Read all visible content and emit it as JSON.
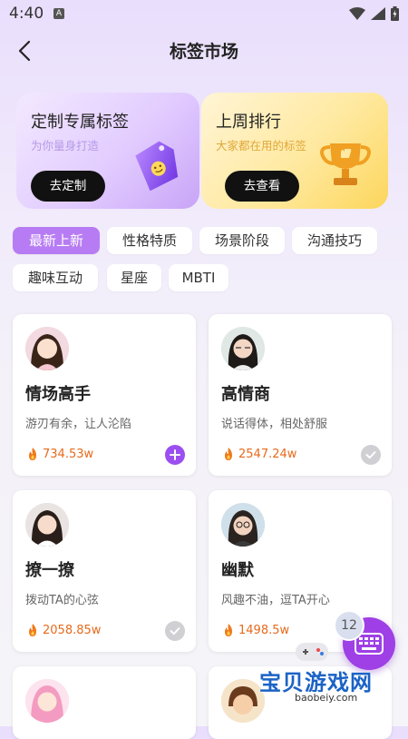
{
  "status": {
    "time": "4:40",
    "notif": "A"
  },
  "nav": {
    "title": "标签市场"
  },
  "promos": [
    {
      "title": "定制专属标签",
      "subtitle": "为你量身打造",
      "button": "去定制"
    },
    {
      "title": "上周排行",
      "subtitle": "大家都在用的标签",
      "button": "去查看"
    }
  ],
  "categories": [
    "最新上新",
    "性格特质",
    "场景阶段",
    "沟通技巧",
    "趣味互动",
    "星座",
    "MBTI"
  ],
  "active_category": "最新上新",
  "cards": [
    {
      "name": "情场高手",
      "desc": "游刃有余，让人沦陷",
      "hot": "734.53w",
      "state": "add"
    },
    {
      "name": "高情商",
      "desc": "说话得体，相处舒服",
      "hot": "2547.24w",
      "state": "added"
    },
    {
      "name": "撩一撩",
      "desc": "拨动TA的心弦",
      "hot": "2058.85w",
      "state": "added"
    },
    {
      "name": "幽默",
      "desc": "风趣不油，逗TA开心",
      "hot": "1498.5w",
      "state": "add"
    }
  ],
  "fab": {
    "badge": "12",
    "icon": "keyboard-icon"
  },
  "watermark": {
    "title": "宝贝游戏网",
    "url": "baobeiy.com"
  },
  "colors": {
    "accent": "#9c4ff0",
    "hot": "#e86a1c",
    "chip_active": "#b77cf3"
  }
}
